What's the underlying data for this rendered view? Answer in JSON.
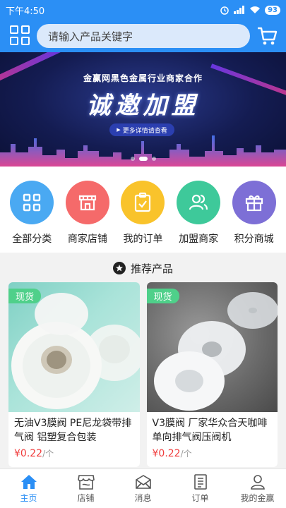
{
  "status_bar": {
    "time": "下午4:50",
    "battery": "93"
  },
  "header": {
    "search_placeholder": "请输入产品关键字"
  },
  "banner": {
    "subtitle": "金赢网黑色金属行业商家合作",
    "headline": "诚邀加盟",
    "more_button": "更多详情请查看"
  },
  "categories": [
    {
      "label": "全部分类",
      "color": "#4aa9f2",
      "icon": "grid-icon"
    },
    {
      "label": "商家店铺",
      "color": "#f56a6a",
      "icon": "store-icon"
    },
    {
      "label": "我的订单",
      "color": "#f9c32b",
      "icon": "clipboard-check-icon"
    },
    {
      "label": "加盟商家",
      "color": "#3ec99a",
      "icon": "users-icon"
    },
    {
      "label": "积分商城",
      "color": "#7d6fd6",
      "icon": "gift-icon"
    }
  ],
  "recommend": {
    "title": "推荐产品"
  },
  "products": [
    {
      "tag": "现货",
      "name": "无油V3膜阀 PE尼龙袋带排气阀 铝塑复合包装",
      "price": "¥0.22",
      "unit": "/个"
    },
    {
      "tag": "现货",
      "name": "V3膜阀 厂家华众合天咖啡单向排气阀压阀机",
      "price": "¥0.22",
      "unit": "/个"
    }
  ],
  "bottom_nav": [
    {
      "label": "主页",
      "icon": "home-icon",
      "active": true
    },
    {
      "label": "店铺",
      "icon": "shop-icon",
      "active": false
    },
    {
      "label": "消息",
      "icon": "mail-icon",
      "active": false
    },
    {
      "label": "订单",
      "icon": "order-icon",
      "active": false
    },
    {
      "label": "我的金赢",
      "icon": "user-icon",
      "active": false
    }
  ],
  "colors": {
    "primary": "#2b8ff5",
    "price": "#f03c3c",
    "tag": "#4fd08a"
  }
}
